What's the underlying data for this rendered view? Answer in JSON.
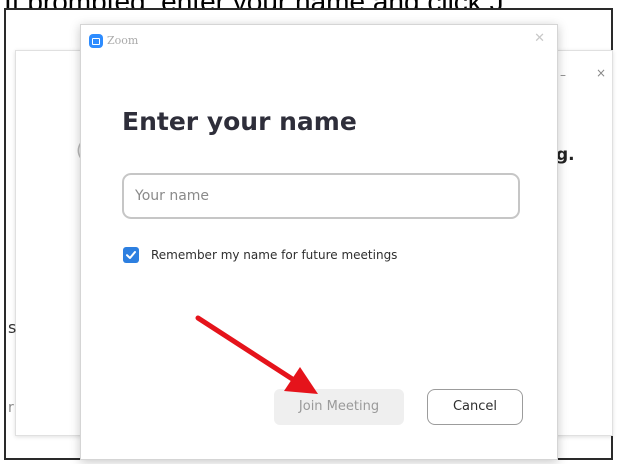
{
  "instruction_text": "If prompted, enter your name and click J",
  "background_window": {
    "visible_text_fragment": "g.",
    "left_fragment_1": "s",
    "left_fragment_2": "r",
    "paren_fragment": "("
  },
  "dialog": {
    "app_title": "Zoom",
    "heading": "Enter your name",
    "name_input": {
      "placeholder": "Your name",
      "value": ""
    },
    "remember_checkbox": {
      "checked": true,
      "label": "Remember my name for future meetings"
    },
    "join_button_label": "Join Meeting",
    "cancel_button_label": "Cancel"
  },
  "colors": {
    "accent": "#2d8cff",
    "checkbox": "#2d7fe0",
    "annotation_arrow": "#e5131b"
  }
}
